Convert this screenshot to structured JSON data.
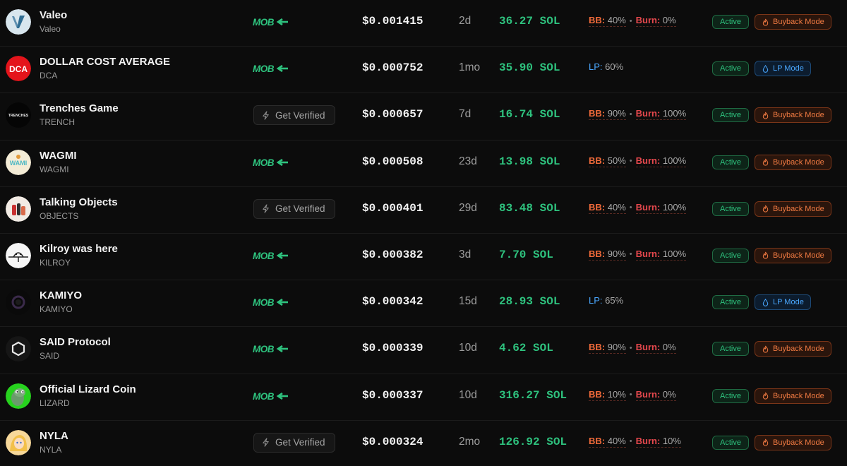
{
  "colors": {
    "volume_green": "#2ec27e",
    "bb_orange": "#f06a3a",
    "burn_red": "#e5484d",
    "lp_blue": "#4aa8ff",
    "active_green": "#2ec27e"
  },
  "labels": {
    "get_verified": "Get Verified",
    "active": "Active",
    "buyback_mode": "Buyback Mode",
    "lp_mode": "LP Mode",
    "bb": "BB:",
    "burn": "Burn:",
    "lp": "LP:",
    "mobk_logo": "MOBK"
  },
  "tokens": [
    {
      "name": "Valeo",
      "ticker": "Valeo",
      "avatar_icon": "valeo-logo-icon",
      "verified": true,
      "price": "$0.001415",
      "age": "2d",
      "volume": "36.27 SOL",
      "mode": "buyback",
      "bb": "40%",
      "burn": "0%",
      "status": "Active",
      "mode_label": "Buyback Mode"
    },
    {
      "name": "DOLLAR COST AVERAGE",
      "ticker": "DCA",
      "avatar_icon": "dca-logo-icon",
      "verified": true,
      "price": "$0.000752",
      "age": "1mo",
      "volume": "35.90 SOL",
      "mode": "lp",
      "lp": "60%",
      "status": "Active",
      "mode_label": "LP Mode"
    },
    {
      "name": "Trenches Game",
      "ticker": "TRENCH",
      "avatar_icon": "trenches-logo-icon",
      "verified": false,
      "price": "$0.000657",
      "age": "7d",
      "volume": "16.74 SOL",
      "mode": "buyback",
      "bb": "90%",
      "burn": "100%",
      "status": "Active",
      "mode_label": "Buyback Mode"
    },
    {
      "name": "WAGMI",
      "ticker": "WAGMI",
      "avatar_icon": "wagmi-logo-icon",
      "verified": true,
      "price": "$0.000508",
      "age": "23d",
      "volume": "13.98 SOL",
      "mode": "buyback",
      "bb": "50%",
      "burn": "100%",
      "status": "Active",
      "mode_label": "Buyback Mode"
    },
    {
      "name": "Talking Objects",
      "ticker": "OBJECTS",
      "avatar_icon": "talking-objects-logo-icon",
      "verified": false,
      "price": "$0.000401",
      "age": "29d",
      "volume": "83.48 SOL",
      "mode": "buyback",
      "bb": "40%",
      "burn": "100%",
      "status": "Active",
      "mode_label": "Buyback Mode"
    },
    {
      "name": "Kilroy was here",
      "ticker": "KILROY",
      "avatar_icon": "kilroy-logo-icon",
      "verified": true,
      "price": "$0.000382",
      "age": "3d",
      "volume": "7.70 SOL",
      "mode": "buyback",
      "bb": "90%",
      "burn": "100%",
      "status": "Active",
      "mode_label": "Buyback Mode"
    },
    {
      "name": "KAMIYO",
      "ticker": "KAMIYO",
      "avatar_icon": "kamiyo-logo-icon",
      "verified": true,
      "price": "$0.000342",
      "age": "15d",
      "volume": "28.93 SOL",
      "mode": "lp",
      "lp": "65%",
      "status": "Active",
      "mode_label": "LP Mode"
    },
    {
      "name": "SAID Protocol",
      "ticker": "SAID",
      "avatar_icon": "said-logo-icon",
      "verified": true,
      "price": "$0.000339",
      "age": "10d",
      "volume": "4.62 SOL",
      "mode": "buyback",
      "bb": "90%",
      "burn": "0%",
      "status": "Active",
      "mode_label": "Buyback Mode"
    },
    {
      "name": "Official Lizard Coin",
      "ticker": "LIZARD",
      "avatar_icon": "lizard-logo-icon",
      "verified": true,
      "price": "$0.000337",
      "age": "10d",
      "volume": "316.27 SOL",
      "mode": "buyback",
      "bb": "10%",
      "burn": "0%",
      "status": "Active",
      "mode_label": "Buyback Mode"
    },
    {
      "name": "NYLA",
      "ticker": "NYLA",
      "avatar_icon": "nyla-logo-icon",
      "verified": false,
      "price": "$0.000324",
      "age": "2mo",
      "volume": "126.92 SOL",
      "mode": "buyback",
      "bb": "40%",
      "burn": "10%",
      "status": "Active",
      "mode_label": "Buyback Mode"
    }
  ]
}
